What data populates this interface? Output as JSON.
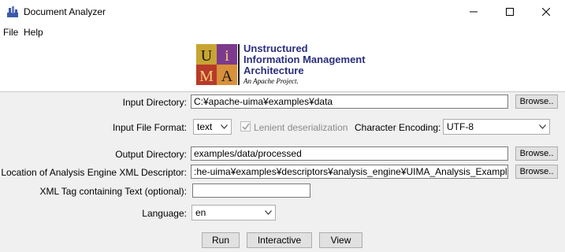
{
  "window": {
    "title": "Document Analyzer",
    "icons": {
      "app": "uima-app-icon",
      "minimize": "minimize-icon",
      "maximize": "maximize-icon",
      "close": "close-icon"
    }
  },
  "menu": {
    "items": [
      "File",
      "Help"
    ]
  },
  "banner": {
    "logo_letters": [
      "U",
      "i",
      "M",
      "A"
    ],
    "line1": "Unstructured",
    "line2": "Information Management",
    "line3": "Architecture",
    "tagline": "An Apache Project."
  },
  "form": {
    "input_directory": {
      "label": "Input Directory:",
      "value": "C:¥apache-uima¥examples¥data",
      "browse": "Browse.."
    },
    "input_format": {
      "label": "Input File Format:",
      "value": "text"
    },
    "lenient": {
      "label": "Lenient deserialization",
      "checked": true,
      "enabled": false
    },
    "encoding": {
      "label": "Character Encoding:",
      "value": "UTF-8"
    },
    "output_directory": {
      "label": "Output Directory:",
      "value": "examples/data/processed",
      "browse": "Browse.."
    },
    "descriptor": {
      "label": "Location of Analysis Engine XML Descriptor:",
      "value": ":he-uima¥examples¥descriptors¥analysis_engine¥UIMA_Analysis_Example.xml",
      "browse": "Browse.."
    },
    "xml_tag": {
      "label": "XML Tag containing Text (optional):",
      "value": ""
    },
    "language": {
      "label": "Language:",
      "value": "en"
    }
  },
  "buttons": {
    "run": "Run",
    "interactive": "Interactive",
    "view": "View"
  },
  "colors": {
    "logo_text": "#2a2e7c",
    "logo_tile_colors": [
      "#c8a432",
      "#7c3a8c",
      "#b83a2a",
      "#d8903a"
    ]
  }
}
